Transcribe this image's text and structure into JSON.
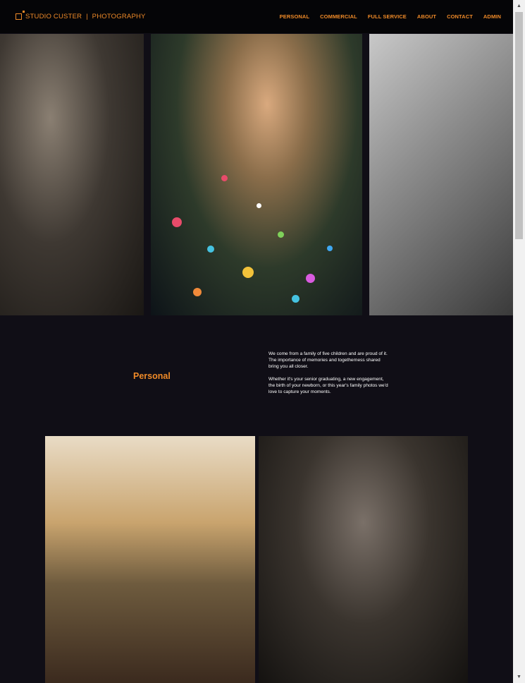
{
  "brand": {
    "name": "STUDIO CUSTER",
    "separator": "|",
    "tagline": "PHOTOGRAPHY",
    "color": "#ef8a28"
  },
  "nav": [
    {
      "label": "PERSONAL"
    },
    {
      "label": "COMMERCIAL"
    },
    {
      "label": "FULL SERVICE"
    },
    {
      "label": "ABOUT"
    },
    {
      "label": "CONTACT"
    },
    {
      "label": "ADMIN"
    }
  ],
  "section": {
    "title": "Personal",
    "paragraphs": [
      "We come from a family of five children and are proud of it. The importance of memories and togetherness shared bring you all closer.",
      "Whether it's your senior graduating, a new engagement, the birth of your newborn, or this year's family photos we'd love to capture your moments."
    ]
  },
  "colors": {
    "background": "#100e16",
    "header": "#050507",
    "accent": "#ef8a28"
  }
}
